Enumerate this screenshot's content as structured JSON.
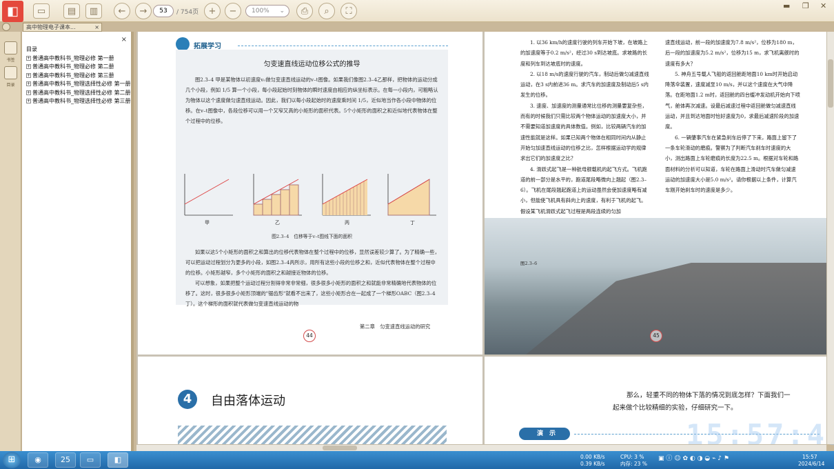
{
  "toolbar": {
    "page_current": "53",
    "page_total": "/ 754页",
    "zoom": "100%"
  },
  "tab": {
    "title": "高中物理电子课本..."
  },
  "left_panel": {
    "item1": "书签",
    "item2": "目录"
  },
  "outline": {
    "root": "目录",
    "items": [
      "普通高中教科书_物理必修 第一册",
      "普通高中教科书_物理必修 第二册",
      "普通高中教科书_物理必修 第三册",
      "普通高中教科书_物理选择性必修 第一册",
      "普通高中教科书_物理选择性必修 第二册",
      "普通高中教科书_物理选择性必修 第三册"
    ]
  },
  "page44": {
    "section_label": "拓展学习",
    "title": "匀变速直线运动位移公式的推导",
    "para1": "图2.3–4 甲是某物体以初速度v₀做匀变速直线运动的v–t图像。如果我们像图2.3–4乙那样，把物体的运动分成几个小段，例如 1/5 算一个小段，每小段起始时刻物体的瞬时速度由相应的纵坐标表示。在每一小段内，可粗略认为物体以这个速度做匀速直线运动。因此，我们以每小段起始时的速度乘时间 1/5，近似地当作各小段中物体的位移。在v–t图像中，各段位移可以用一个又窄又高的小矩形的面积代表。5个小矩形的面积之和近似地代表物体在整个过程中的位移。",
    "fig_labels": [
      "甲",
      "乙",
      "丙",
      "丁"
    ],
    "caption": "图2.3–4　位移等于v–t图线下面的面积",
    "para2": "如果以这5个小矩形的面积之和算出的位移代表物体在整个过程中的位移，显然误差较少算了。为了精确一些，可以把运动过程划分为更多的小段，如图2.3–4丙所示，用所有这些小段的位移之和，近似代表物体在整个过程中的位移。小矩形越窄，多个小矩形的面积之和越接近物体的位移。",
    "para3": "可以想象，如果把整个运动过程分割得非常非常细，很多很多小矩形的面积之和就能非常精确地代表物体的位移了。这时，很多很多小矩形顶端的\"锯齿形\"就看不出来了，这些小矩形合在一起成了一个梯形OABC（图2.3–4丁）。这个梯形的面积就代表做匀变速直线运动的物",
    "footer": "第二章　匀变速直线运动的研究",
    "page_num": "44"
  },
  "page45": {
    "col1": [
      "1. 以36 km/h的速度行驶的列车开始下坡，在坡路上的加速度等于0.2 m/s²，经过30 s到达坡底。求坡路的长度和列车到达坡底时的速度。",
      "2. 以18 m/s的速度行驶的汽车，制动后做匀减速直线运动，在3 s内前进36 m。求汽车的加速度及制动后5 s内发生的位移。",
      "3. 速度、加速度的测量通常比位移的测量要复杂些，而有的时候我们只需比较两个物体运动的加速度大小，并不需要知道加速度的具体数值。例如，比较两辆汽车的加速性能就是这样。如果已知两个物体在相同时间内从静止开始匀加速直线运动的位移之比，怎样根据运动学的规律求出它们的加速度之比？",
      "4. 滑跃式起飞是一种航母舰载机的起飞方式。飞机跑道的前一部分是水平的，跑道尾段略微向上翘起（图2.3–6）。飞机在尾段翘起跑道上的运动虽然会使加速度略有减小，但能使飞机具有斜向上的速度，有利于飞机的起飞。假设某飞机滑跃式起飞过程是两段连续的匀加"
    ],
    "col2": [
      "速直线运动，前一段的加速度为7.8 m/s²，位移为180 m，后一段的加速度为5.2 m/s²，位移为15 m，求飞机离舰时的速度有多大？",
      "5. 神舟五号载人飞船的返回舱距地面10 km时开始启动降落伞装置，速度减至10 m/s，并以这个速度在大气中降落。在距地面1.2 m时，返回舱的四台缓冲发动机开始向下喷气，舱体再次减速。设最后减速过程中返回舱做匀减速直线运动，并且到达地面时恰好速度为0，求最后减速阶段的加速度。",
      "6. 一辆肇事汽车在紧急刹车后停了下来，路面上留下了一条车轮滑动的磨痕。警察为了判断汽车刹车时速度的大小，测出路面上车轮磨痕的长度为22.5 m。根据对车轮和路面材料的分析可以知道，车轮在路面上滑动时汽车做匀减速运动的加速度大小是5.0 m/s²。请你根据以上条件，计算汽车刚开始刹车时的速度是多少。"
    ],
    "fig_label": "图2.3–6",
    "page_num": "45"
  },
  "page46": {
    "chapter_num": "4",
    "title": "自由落体运动"
  },
  "page47": {
    "text": "那么，轻重不同的物体下落的情况到底怎样？下面我们一起来做个比较精细的实验，仔细研究一下。",
    "demo_label": "演　示"
  },
  "overlay_clock": "15:57:45",
  "taskbar": {
    "calendar_day": "25",
    "net_up": "0.00 KB/s",
    "net_down": "0.39 KB/s",
    "cpu": "CPU: 3 %",
    "mem": "内存: 23 %",
    "time": "15:57",
    "date": "2024/6/14"
  }
}
